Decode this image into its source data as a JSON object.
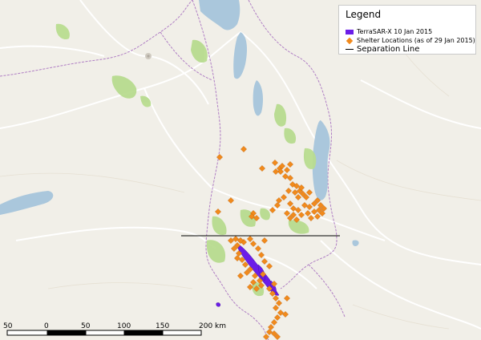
{
  "legend": {
    "title": "Legend",
    "items": [
      {
        "label": "TerraSAR-X 10 Jan 2015",
        "symbol": "rectangle",
        "color": "#6b1de8"
      },
      {
        "label": "Shelter Locations (as of 29 Jan 2015)",
        "symbol": "diamond",
        "color": "#f18a1c"
      },
      {
        "label": "Separation Line",
        "symbol": "line",
        "color": "#000000"
      }
    ]
  },
  "scale_bar": {
    "labels": [
      "50",
      "0",
      "50",
      "100",
      "150",
      "200 km"
    ]
  },
  "colors": {
    "land": "#f1efe8",
    "water": "#aac7dc",
    "protected_area": "#b8dc8f",
    "border": "#b07fc4",
    "road": "#ffffff",
    "flood": "#6b1de8",
    "shelter": "#f18a1c"
  }
}
